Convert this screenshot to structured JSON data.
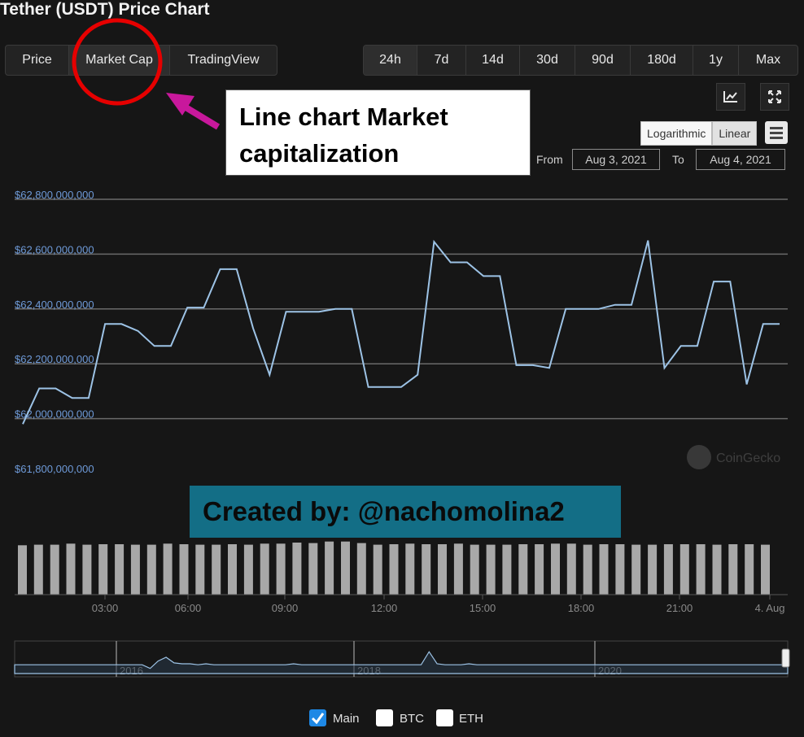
{
  "title": "Tether (USDT) Price Chart",
  "view_tabs": [
    {
      "label": "Price",
      "active": false
    },
    {
      "label": "Market Cap",
      "active": true
    },
    {
      "label": "TradingView",
      "active": false
    }
  ],
  "range_tabs": [
    {
      "label": "24h",
      "active": true
    },
    {
      "label": "7d",
      "active": false
    },
    {
      "label": "14d",
      "active": false
    },
    {
      "label": "30d",
      "active": false
    },
    {
      "label": "90d",
      "active": false
    },
    {
      "label": "180d",
      "active": false
    },
    {
      "label": "1y",
      "active": false
    },
    {
      "label": "Max",
      "active": false
    }
  ],
  "toolbar_icons": [
    "line-chart-icon",
    "fullscreen-icon"
  ],
  "scale": {
    "logarithmic": "Logarithmic",
    "linear": "Linear",
    "active": "Linear"
  },
  "menu_icon": "hamburger-menu-icon",
  "date_range": {
    "from_label": "From",
    "from_value": "Aug 3, 2021",
    "to_label": "To",
    "to_value": "Aug 4, 2021"
  },
  "annotation": {
    "text": "Line chart Market capitalization",
    "arrow_color": "#c8189c",
    "circle_color": "#e60000"
  },
  "credit": "Created by: @nachomolina2",
  "watermark": "CoinGecko",
  "legend": [
    {
      "label": "Main",
      "checked": true
    },
    {
      "label": "BTC",
      "checked": false
    },
    {
      "label": "ETH",
      "checked": false
    }
  ],
  "colors": {
    "line": "#9dc3e6",
    "axis_label": "#6e9ad8",
    "checkbox_checked": "#1e88e5",
    "credit_bg": "#136e86"
  },
  "chart_data": {
    "type": "line",
    "title": "",
    "xlabel": "",
    "ylabel": "",
    "ylim": [
      61800000000,
      62800000000
    ],
    "y_ticks": [
      "$61,800,000,000",
      "$62,000,000,000",
      "$62,200,000,000",
      "$62,400,000,000",
      "$62,600,000,000",
      "$62,800,000,000"
    ],
    "x_ticks": [
      "03:00",
      "06:00",
      "09:00",
      "12:00",
      "15:00",
      "18:00",
      "21:00",
      "4. Aug"
    ],
    "grid": true,
    "series": [
      {
        "name": "Main",
        "values": [
          61980000000,
          62110000000,
          62110000000,
          62075000000,
          62075000000,
          62345000000,
          62345000000,
          62320000000,
          62265000000,
          62265000000,
          62405000000,
          62405000000,
          62545000000,
          62545000000,
          62330000000,
          62160000000,
          62390000000,
          62390000000,
          62390000000,
          62400000000,
          62400000000,
          62115000000,
          62115000000,
          62115000000,
          62160000000,
          62645000000,
          62570000000,
          62570000000,
          62520000000,
          62520000000,
          62195000000,
          62195000000,
          62185000000,
          62400000000,
          62400000000,
          62400000000,
          62415000000,
          62415000000,
          62650000000,
          62185000000,
          62265000000,
          62265000000,
          62500000000,
          62500000000,
          62125000000,
          62345000000,
          62345000000
        ]
      }
    ],
    "volume_relative": [
      0.92,
      0.93,
      0.93,
      0.95,
      0.93,
      0.94,
      0.94,
      0.93,
      0.93,
      0.95,
      0.94,
      0.93,
      0.93,
      0.94,
      0.93,
      0.95,
      0.95,
      0.97,
      0.96,
      0.99,
      0.99,
      0.96,
      0.93,
      0.94,
      0.95,
      0.94,
      0.94,
      0.95,
      0.93,
      0.93,
      0.93,
      0.94,
      0.94,
      0.95,
      0.95,
      0.93,
      0.94,
      0.94,
      0.93,
      0.93,
      0.94,
      0.94,
      0.94,
      0.93,
      0.94,
      0.94,
      0.93
    ],
    "navigator": {
      "labels": [
        "2016",
        "2018",
        "2020"
      ],
      "values": [
        0.3,
        0.3,
        0.3,
        0.3,
        0.3,
        0.3,
        0.3,
        0.3,
        0.3,
        0.3,
        0.3,
        0.3,
        0.3,
        0.3,
        0.3,
        0.3,
        0.3,
        0.1,
        0.5,
        0.7,
        0.4,
        0.35,
        0.35,
        0.3,
        0.35,
        0.3,
        0.3,
        0.3,
        0.3,
        0.3,
        0.3,
        0.3,
        0.3,
        0.3,
        0.3,
        0.35,
        0.3,
        0.3,
        0.3,
        0.3,
        0.3,
        0.3,
        0.3,
        0.3,
        0.3,
        0.3,
        0.3,
        0.3,
        0.3,
        0.3,
        0.3,
        0.3,
        1.0,
        0.35,
        0.3,
        0.3,
        0.3,
        0.35,
        0.3,
        0.3,
        0.3,
        0.3,
        0.3,
        0.3,
        0.3,
        0.3,
        0.3,
        0.3,
        0.3,
        0.3,
        0.3,
        0.3,
        0.3,
        0.3,
        0.3,
        0.3,
        0.3,
        0.3,
        0.3,
        0.3,
        0.3,
        0.3,
        0.3,
        0.3,
        0.3,
        0.3,
        0.3,
        0.3,
        0.3,
        0.3,
        0.3,
        0.3,
        0.3,
        0.3,
        0.3,
        0.3,
        0.3,
        0.3
      ]
    }
  }
}
